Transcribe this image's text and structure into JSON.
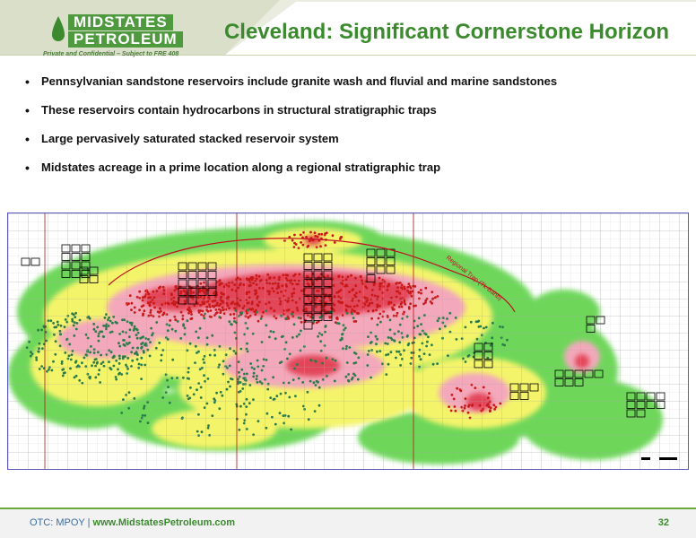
{
  "header": {
    "logo_line1": "MIDSTATES",
    "logo_line2": "PETROLEUM",
    "confidential": "Private and Confidential – Subject to FRE 408",
    "title": "Cleveland: Significant Cornerstone Horizon"
  },
  "bullets": [
    "Pennsylvanian sandstone reservoirs include granite wash and fluvial and marine sandstones",
    "These reservoirs contain hydrocarbons in structural stratigraphic traps",
    "Large pervasively saturated stacked reservoir system",
    "Midstates acreage in a prime location along a regional stratigraphic trap"
  ],
  "map": {
    "trap_label": "Regional Trap (Tk-Bahb)",
    "colors": {
      "green": "#5fd34a",
      "yellow": "#f4f46a",
      "pink": "#f3a9bb",
      "red": "#e0364a",
      "well": "#c81818",
      "grid": "#9a9a9a",
      "lease": "#000000"
    }
  },
  "footer": {
    "ticker": "OTC: MPOY",
    "sep": " | ",
    "website": "www.MidstatesPetroleum.com",
    "page": "32"
  }
}
